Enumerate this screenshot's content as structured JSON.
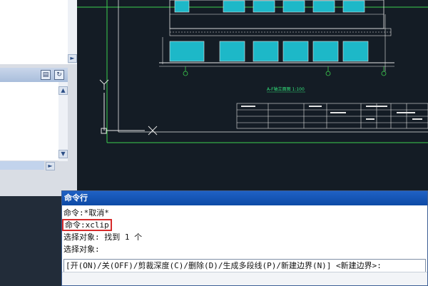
{
  "command_window": {
    "title": "命令行",
    "lines": [
      "命令:*取消*",
      "命令:xclip",
      "选择对象: 找到 1 个",
      "选择对象:"
    ],
    "prompt": "[开(ON)/关(OFF)/剪裁深度(C)/删除(D)/生成多段线(P)/新建边界(N)] <新建边界>:"
  },
  "drawing": {
    "caption": "A-F轴立面图 1:100",
    "ucs_y_label": "Y",
    "colors": {
      "background": "#141c25",
      "building_line": "#e6e6e6",
      "window_fill": "#1db8c8",
      "frame_green": "#3ccf4e",
      "caption_color": "#32e07a"
    }
  },
  "icons": {
    "scroll_up": "▲",
    "scroll_down": "▼",
    "scroll_right": "►",
    "panel_btn_1": "▤",
    "panel_btn_2": "↻"
  }
}
